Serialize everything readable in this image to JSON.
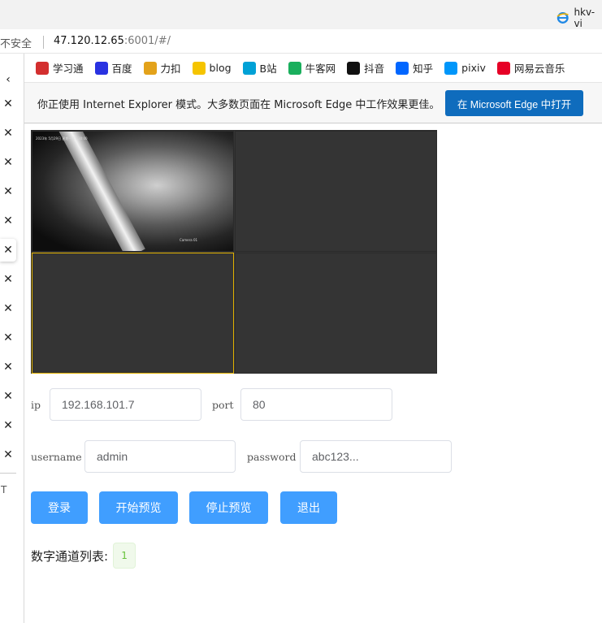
{
  "browser": {
    "tab_title": "hkv-vi",
    "security_label": "不安全",
    "url_host": "47.120.12.65",
    "url_rest": ":6001/#/"
  },
  "bookmarks": [
    {
      "label": "学习通",
      "icon": "xuexitong-icon",
      "color": "#d32f2f"
    },
    {
      "label": "百度",
      "icon": "baidu-paw-icon",
      "color": "#2932e1"
    },
    {
      "label": "力扣",
      "icon": "leetcode-icon",
      "color": "#e3a21a"
    },
    {
      "label": "blog",
      "icon": "sun-icon",
      "color": "#f5c400"
    },
    {
      "label": "B站",
      "icon": "bilibili-icon",
      "color": "#00a1d6"
    },
    {
      "label": "牛客网",
      "icon": "nowcoder-icon",
      "color": "#1aaf5d"
    },
    {
      "label": "抖音",
      "icon": "douyin-icon",
      "color": "#111111"
    },
    {
      "label": "知乎",
      "icon": "zhihu-icon",
      "color": "#0066ff"
    },
    {
      "label": "pixiv",
      "icon": "pixiv-icon",
      "color": "#0096fa"
    },
    {
      "label": "网易云音乐",
      "icon": "netease-music-icon",
      "color": "#e60026"
    }
  ],
  "ie_bar": {
    "message": "你正使用 Internet Explorer 模式。大多数页面在 Microsoft Edge 中工作效果更佳。",
    "button": "在 Microsoft Edge 中打开"
  },
  "sidebar": {
    "back": "‹",
    "close_glyph": "✕",
    "close_count": 13,
    "active_index": 5,
    "bottom_text": "T"
  },
  "video": {
    "timestamp": "2023年 5月29日 星期一 17:30:00",
    "camera_label": "Camera 01",
    "selected_window": 3
  },
  "form": {
    "ip_label": "ip",
    "ip_value": "192.168.101.7",
    "port_label": "port",
    "port_value": "80",
    "username_label": "username",
    "username_value": "admin",
    "password_label": "password",
    "password_value": "abc123..."
  },
  "buttons": {
    "login": "登录",
    "start_preview": "开始预览",
    "stop_preview": "停止预览",
    "logout": "退出"
  },
  "channels": {
    "label": "数字通道列表:",
    "items": [
      "1"
    ]
  },
  "colors": {
    "primary": "#409eff",
    "edge_blue": "#0f6cbd",
    "selected_border": "#e0b000",
    "tag_green": "#67c23a"
  }
}
